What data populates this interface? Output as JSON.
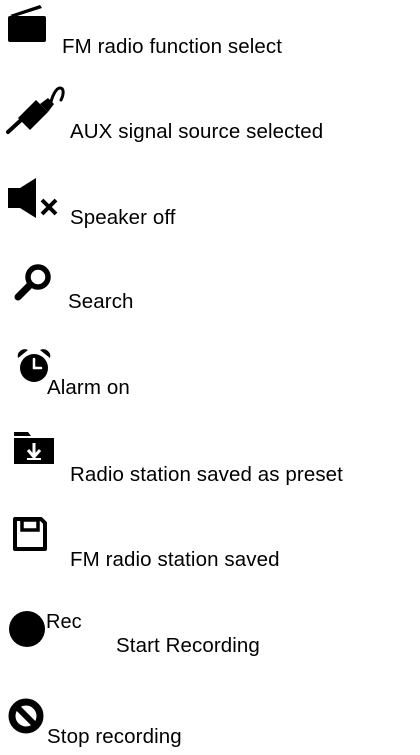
{
  "legend": {
    "items": [
      {
        "icon": "radio-icon",
        "label": "FM radio function select"
      },
      {
        "icon": "aux-cable-icon",
        "label": "AUX signal source selected"
      },
      {
        "icon": "speaker-off-icon",
        "label": "Speaker off"
      },
      {
        "icon": "search-icon",
        "label": "Search"
      },
      {
        "icon": "alarm-clock-icon",
        "label": "Alarm on"
      },
      {
        "icon": "folder-download-icon",
        "label": "Radio station saved as preset"
      },
      {
        "icon": "floppy-disk-icon",
        "label": "FM radio station saved"
      },
      {
        "icon": "record-dot-icon",
        "label": "Start Recording",
        "icon_text": "Rec"
      },
      {
        "icon": "prohibited-icon",
        "label": "Stop recording"
      }
    ]
  },
  "colors": {
    "text": "#000000",
    "icon": "#000000",
    "background": "#ffffff"
  }
}
